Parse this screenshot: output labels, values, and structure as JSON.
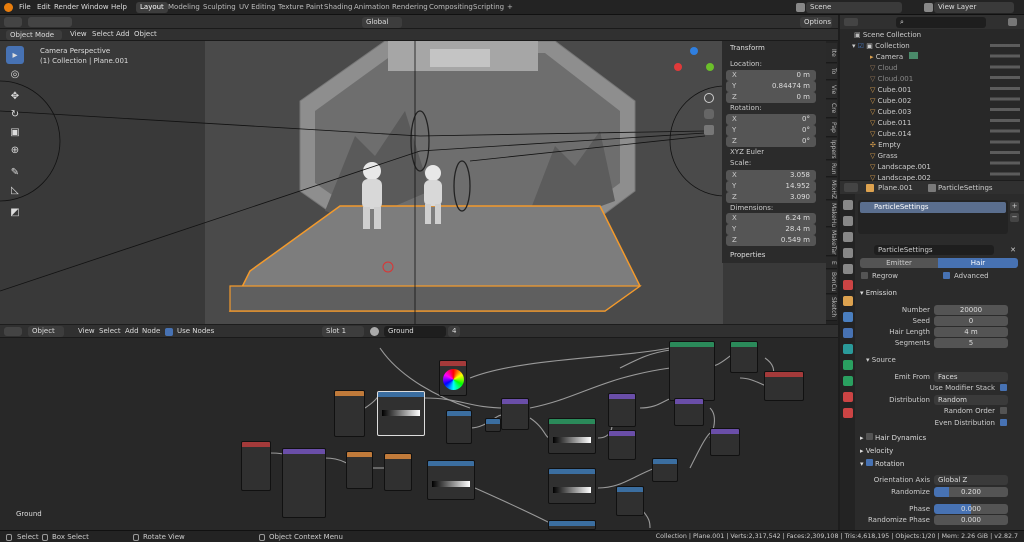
{
  "top_menu": [
    "File",
    "Edit",
    "Render",
    "Window",
    "Help"
  ],
  "workspaces": [
    "Layout",
    "Modeling",
    "Sculpting",
    "UV Editing",
    "Texture Paint",
    "Shading",
    "Animation",
    "Rendering",
    "Compositing",
    "Scripting"
  ],
  "active_workspace": "Layout",
  "add_workspace": "+",
  "scene": "Scene",
  "view_layer": "View Layer",
  "viewport": {
    "mode": "Object Mode",
    "menus": [
      "View",
      "Select",
      "Add",
      "Object"
    ],
    "transform_orientation": "Global",
    "options_label": "Options",
    "overlay_line1": "Camera Perspective",
    "overlay_line2": "(1) Collection | Plane.001"
  },
  "npanel": {
    "transform_title": "Transform",
    "location_label": "Location:",
    "location": [
      [
        "X",
        "0 m"
      ],
      [
        "Y",
        "0.84474 m"
      ],
      [
        "Z",
        "0 m"
      ]
    ],
    "rotation_label": "Rotation:",
    "rotation": [
      [
        "X",
        "0°"
      ],
      [
        "Y",
        "0°"
      ],
      [
        "Z",
        "0°"
      ]
    ],
    "rotation_mode": "XYZ Euler",
    "scale_label": "Scale:",
    "scale": [
      [
        "X",
        "3.058"
      ],
      [
        "Y",
        "14.952"
      ],
      [
        "Z",
        "3.090"
      ]
    ],
    "dimensions_label": "Dimensions:",
    "dimensions": [
      [
        "X",
        "6.24 m"
      ],
      [
        "Y",
        "28.4 m"
      ],
      [
        "Z",
        "0.549 m"
      ]
    ],
    "properties_title": "Properties",
    "tabs": [
      "Ite",
      "To",
      "Vie",
      "Cre",
      "Pap",
      "Ippers",
      "Run",
      "MixHZ",
      "MakeHu",
      "MakeTar",
      "E",
      "BonCu",
      "Sketch"
    ]
  },
  "node_editor": {
    "type_menu": "Object",
    "menus": [
      "View",
      "Select",
      "Add",
      "Node"
    ],
    "use_nodes": "Use Nodes",
    "slot": "Slot 1",
    "material": "Ground",
    "users": "4",
    "frame_label": "Ground"
  },
  "outliner": {
    "search_placeholder": "",
    "root": "Scene Collection",
    "items": [
      "Collection",
      "Camera",
      "Cloud",
      "Cloud.001",
      "Cube.001",
      "Cube.002",
      "Cube.003",
      "Cube.011",
      "Cube.014",
      "Empty",
      "Grass",
      "Landscape.001",
      "Landscape.002"
    ]
  },
  "properties": {
    "object": "Plane.001",
    "psys": "ParticleSettings",
    "list_item": "ParticleSettings",
    "settings_name": "ParticleSettings",
    "emitter": "Emitter",
    "hair": "Hair",
    "regrow": "Regrow",
    "advanced": "Advanced",
    "emission": "Emission",
    "number_label": "Number",
    "number": "20000",
    "seed_label": "Seed",
    "seed": "0",
    "hair_length_label": "Hair Length",
    "hair_length": "4 m",
    "segments_label": "Segments",
    "segments": "5",
    "source": "Source",
    "emit_from_label": "Emit From",
    "emit_from": "Faces",
    "use_modifier_stack": "Use Modifier Stack",
    "distribution_label": "Distribution",
    "distribution": "Random",
    "random_order": "Random Order",
    "even_distribution": "Even Distribution",
    "hair_dynamics": "Hair Dynamics",
    "velocity": "Velocity",
    "rotation": "Rotation",
    "orientation_axis_label": "Orientation Axis",
    "orientation_axis": "Global Z",
    "randomize_label": "Randomize",
    "randomize": "0.200",
    "phase_label": "Phase",
    "phase": "0.000",
    "randomize_phase_label": "Randomize Phase",
    "randomize_phase": "0.000"
  },
  "statusbar": {
    "select": "Select",
    "box_select": "Box Select",
    "rotate_view": "Rotate View",
    "context_menu": "Object Context Menu",
    "stats": "Collection | Plane.001 | Verts:2,317,542 | Faces:2,309,108 | Tris:4,618,195 | Objects:1/20 | Mem: 2.26 GiB | v2.82.7"
  },
  "colors": {
    "accent": "#4772b3",
    "active_outline": "#f39a2c",
    "node_header_blue": "#3b6ea0",
    "node_header_red": "#a43a3a",
    "node_header_green": "#2b8a5a",
    "node_header_purple": "#6a4ea8",
    "node_header_orange": "#c07a3a"
  }
}
